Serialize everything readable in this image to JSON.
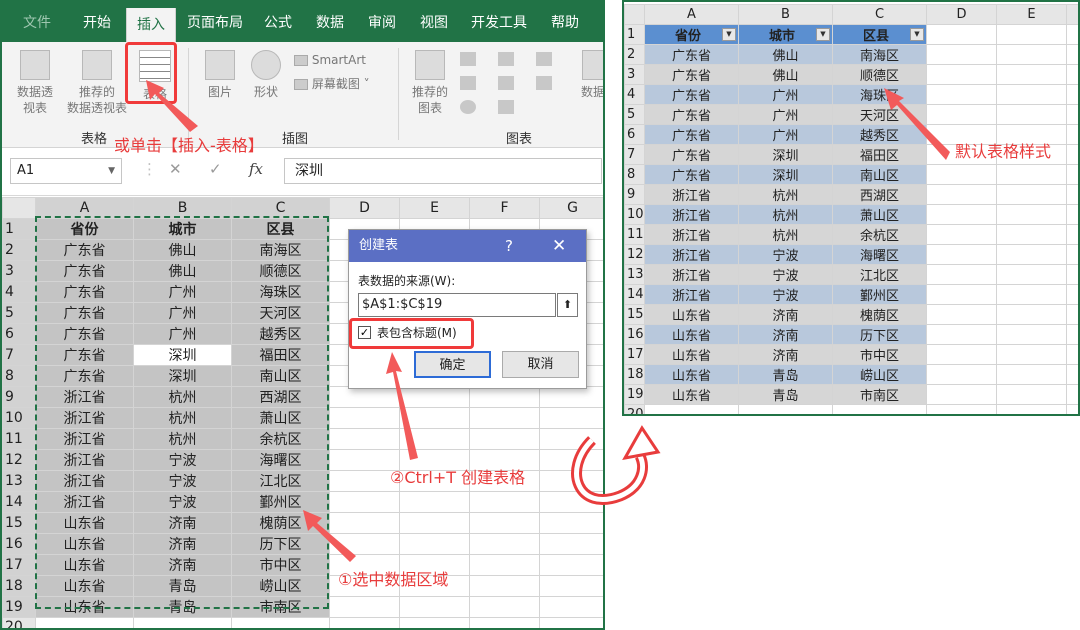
{
  "ribbon": {
    "tabs": [
      "文件",
      "开始",
      "插入",
      "页面布局",
      "公式",
      "数据",
      "审阅",
      "视图",
      "开发工具",
      "帮助"
    ],
    "active_tab": "插入",
    "buttons": {
      "pivot": [
        "数据透",
        "视表"
      ],
      "rec_pivot": [
        "推荐的",
        "数据透视表"
      ],
      "table": "表格",
      "picture": "图片",
      "shapes": "形状",
      "smartart": "SmartArt",
      "screenshot": "屏幕截图",
      "rec_charts": [
        "推荐的",
        "图表"
      ],
      "data_bar": "数据"
    },
    "groups": {
      "tables": "表格",
      "illustrations": "插图",
      "charts": "图表"
    }
  },
  "formula_bar": {
    "name_box": "A1",
    "cancel": "✕",
    "enter": "✓",
    "fx": "fx",
    "content": "深圳"
  },
  "left_sheet": {
    "columns": [
      "A",
      "B",
      "C",
      "D",
      "E",
      "F",
      "G"
    ],
    "header": [
      "省份",
      "城市",
      "区县"
    ],
    "rows": [
      [
        "广东省",
        "佛山",
        "南海区"
      ],
      [
        "广东省",
        "佛山",
        "顺德区"
      ],
      [
        "广东省",
        "广州",
        "海珠区"
      ],
      [
        "广东省",
        "广州",
        "天河区"
      ],
      [
        "广东省",
        "广州",
        "越秀区"
      ],
      [
        "广东省",
        "深圳",
        "福田区"
      ],
      [
        "广东省",
        "深圳",
        "南山区"
      ],
      [
        "浙江省",
        "杭州",
        "西湖区"
      ],
      [
        "浙江省",
        "杭州",
        "萧山区"
      ],
      [
        "浙江省",
        "杭州",
        "余杭区"
      ],
      [
        "浙江省",
        "宁波",
        "海曙区"
      ],
      [
        "浙江省",
        "宁波",
        "江北区"
      ],
      [
        "浙江省",
        "宁波",
        "鄞州区"
      ],
      [
        "山东省",
        "济南",
        "槐荫区"
      ],
      [
        "山东省",
        "济南",
        "历下区"
      ],
      [
        "山东省",
        "济南",
        "市中区"
      ],
      [
        "山东省",
        "青岛",
        "崂山区"
      ],
      [
        "山东省",
        "青岛",
        "市南区"
      ]
    ]
  },
  "dialog": {
    "title": "创建表",
    "help": "?",
    "close": "✕",
    "source_label": "表数据的来源(W):",
    "range": "$A$1:$C$19",
    "checkbox_label": "表包含标题(M)",
    "checked": "✓",
    "ok": "确定",
    "cancel": "取消"
  },
  "right_sheet": {
    "columns": [
      "A",
      "B",
      "C",
      "D",
      "E"
    ]
  },
  "annotations": {
    "insert_table": "或单击【插入-表格】",
    "ctrl_t": "②Ctrl+T 创建表格",
    "select_range": "①选中数据区域",
    "default_style": "默认表格样式"
  },
  "colors": {
    "excel_green": "#217346",
    "annotation_red": "#e83c3c",
    "table_header_blue": "#5b8fd0",
    "dialog_title": "#5b6fc4"
  }
}
